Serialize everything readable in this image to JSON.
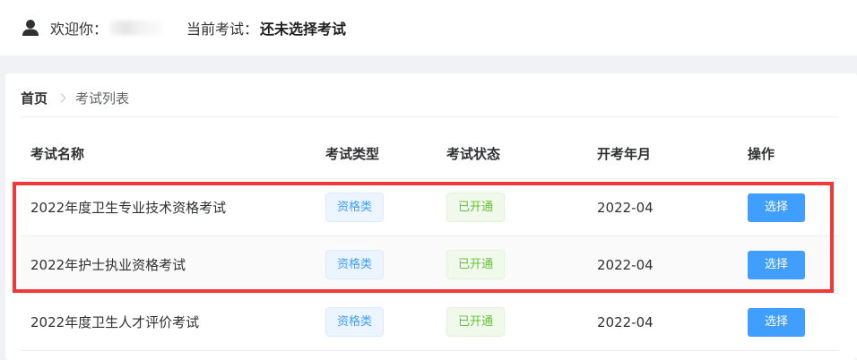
{
  "header": {
    "welcome_label": "欢迎你：",
    "current_exam_label": "当前考试：",
    "current_exam_value": "还未选择考试"
  },
  "breadcrumb": {
    "home": "首页",
    "current": "考试列表"
  },
  "table": {
    "columns": [
      "考试名称",
      "考试类型",
      "考试状态",
      "开考年月",
      "操作"
    ],
    "rows": [
      {
        "name": "2022年度卫生专业技术资格考试",
        "type": "资格类",
        "status": "已开通",
        "date": "2022-04",
        "action": "选择"
      },
      {
        "name": "2022年护士执业资格考试",
        "type": "资格类",
        "status": "已开通",
        "date": "2022-04",
        "action": "选择"
      },
      {
        "name": "2022年度卫生人才评价考试",
        "type": "资格类",
        "status": "已开通",
        "date": "2022-04",
        "action": "选择"
      }
    ]
  },
  "colors": {
    "primary": "#409eff",
    "success": "#67c23a",
    "highlight": "#f03a3a"
  }
}
